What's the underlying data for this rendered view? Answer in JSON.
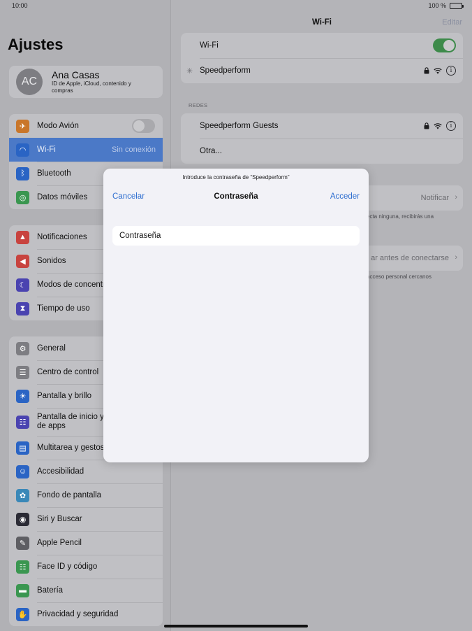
{
  "status": {
    "time": "10:00",
    "battery": "100 %"
  },
  "sidebar": {
    "title": "Ajustes",
    "profile": {
      "initials": "AC",
      "name": "Ana Casas",
      "subtitle": "ID de Apple, iCloud, contenido y compras"
    },
    "group1": [
      {
        "label": "Modo Avión",
        "icon": "airplane-icon",
        "color": "#c9762a"
      },
      {
        "label": "Wi-Fi",
        "value": "Sin conexión",
        "icon": "wifi-icon",
        "color": "#2a64c4",
        "selected": true
      },
      {
        "label": "Bluetooth",
        "icon": "bluetooth-icon",
        "color": "#2a64c4"
      },
      {
        "label": "Datos móviles",
        "icon": "antenna-icon",
        "color": "#3a9650"
      }
    ],
    "group2": [
      {
        "label": "Notificaciones",
        "icon": "bell-icon",
        "color": "#c8433f"
      },
      {
        "label": "Sonidos",
        "icon": "speaker-icon",
        "color": "#c8433f"
      },
      {
        "label": "Modos de concentración",
        "icon": "moon-icon",
        "color": "#4a43b0"
      },
      {
        "label": "Tiempo de uso",
        "icon": "hourglass-icon",
        "color": "#4a43b0"
      }
    ],
    "group3": [
      {
        "label": "General",
        "icon": "gear-icon",
        "color": "#7d7d82"
      },
      {
        "label": "Centro de control",
        "icon": "switches-icon",
        "color": "#7d7d82"
      },
      {
        "label": "Pantalla y brillo",
        "icon": "sun-icon",
        "color": "#2a64c4"
      },
      {
        "label": "Pantalla de inicio y de apps",
        "icon": "grid-icon",
        "color": "#4a43b0"
      },
      {
        "label": "Multitarea y gestos",
        "icon": "multitask-icon",
        "color": "#2a64c4"
      },
      {
        "label": "Accesibilidad",
        "icon": "accessibility-icon",
        "color": "#2a64c4"
      },
      {
        "label": "Fondo de pantalla",
        "icon": "flower-icon",
        "color": "#3a88b8"
      },
      {
        "label": "Siri y Buscar",
        "icon": "siri-icon",
        "color": "#2b2b35"
      },
      {
        "label": "Apple Pencil",
        "icon": "pencil-icon",
        "color": "#5e5e63"
      },
      {
        "label": "Face ID y código",
        "icon": "faceid-icon",
        "color": "#3a9650"
      },
      {
        "label": "Batería",
        "icon": "battery-icon",
        "color": "#3a9650"
      },
      {
        "label": "Privacidad y seguridad",
        "icon": "hand-icon",
        "color": "#2a64c4"
      }
    ]
  },
  "detail": {
    "title": "Wi-Fi",
    "edit": "Editar",
    "wifi_label": "Wi-Fi",
    "current_network": "Speedperform",
    "networks_header": "REDES",
    "networks": [
      "Speedperform Guests"
    ],
    "other": "Otra...",
    "ask_value": "Notificar",
    "ask_footnote": "ecta ninguna, recibirás una",
    "hotspot_value": "ar antes de conectarse",
    "hotspot_footnote": "acceso personal cercanos"
  },
  "modal": {
    "prompt": "Introduce la contraseña de “Speedperform”",
    "cancel": "Cancelar",
    "title": "Contraseña",
    "join": "Acceder",
    "field_placeholder": "Contraseña"
  }
}
